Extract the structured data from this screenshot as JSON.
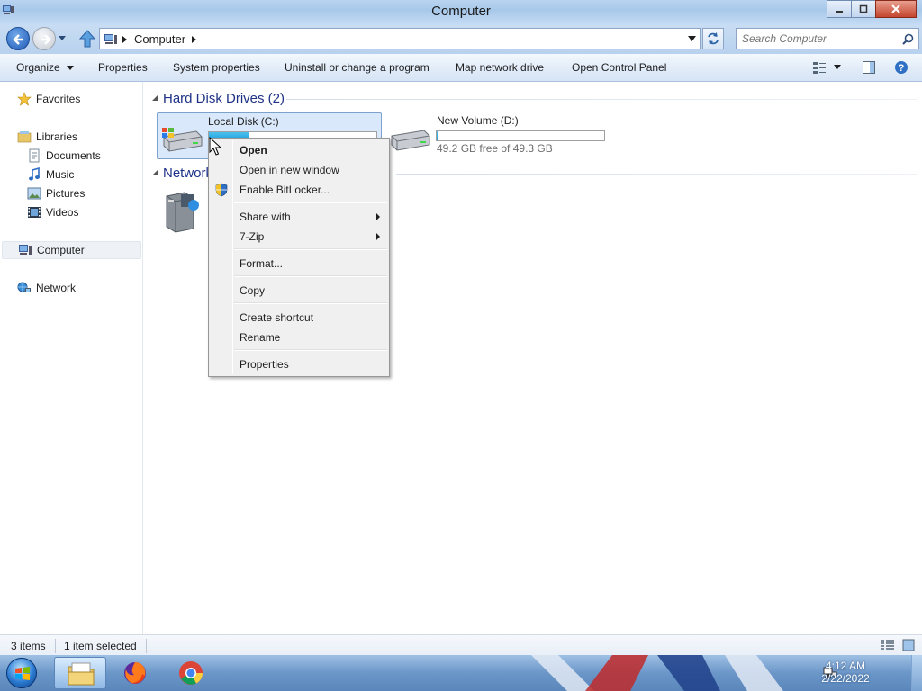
{
  "window": {
    "title": "Computer"
  },
  "address": {
    "crumbs": [
      "Computer"
    ],
    "search_placeholder": "Search Computer"
  },
  "toolbar": {
    "organize": "Organize",
    "properties": "Properties",
    "system_properties": "System properties",
    "uninstall": "Uninstall or change a program",
    "map_drive": "Map network drive",
    "control_panel": "Open Control Panel"
  },
  "nav": {
    "favorites": "Favorites",
    "libraries": "Libraries",
    "documents": "Documents",
    "music": "Music",
    "pictures": "Pictures",
    "videos": "Videos",
    "computer": "Computer",
    "network": "Network"
  },
  "content": {
    "hdd_header": "Hard Disk Drives (2)",
    "network_header": "Network",
    "drives": [
      {
        "name": "Local Disk (C:)",
        "used_fraction": 0.24,
        "selected": true
      },
      {
        "name": "New Volume (D:)",
        "used_fraction": 0.003,
        "free_text": "49.2 GB free of 49.3 GB"
      }
    ]
  },
  "context_menu": {
    "items": [
      {
        "label": "Open",
        "bold": true
      },
      {
        "label": "Open in new window"
      },
      {
        "label": "Enable BitLocker...",
        "icon": "shield-icon"
      },
      {
        "label": "Share with",
        "submenu": true
      },
      {
        "label": "7-Zip",
        "submenu": true
      },
      {
        "label": "Format..."
      },
      {
        "label": "Copy"
      },
      {
        "label": "Create shortcut"
      },
      {
        "label": "Rename"
      },
      {
        "label": "Properties"
      }
    ]
  },
  "status": {
    "items": "3 items",
    "selected": "1 item selected"
  },
  "taskbar": {
    "time": "4:12 AM",
    "date": "2/22/2022"
  },
  "colors": {
    "accent": "#1e3287",
    "selection": "#d9e8fa",
    "bar_fill": "#1e9bd8"
  }
}
